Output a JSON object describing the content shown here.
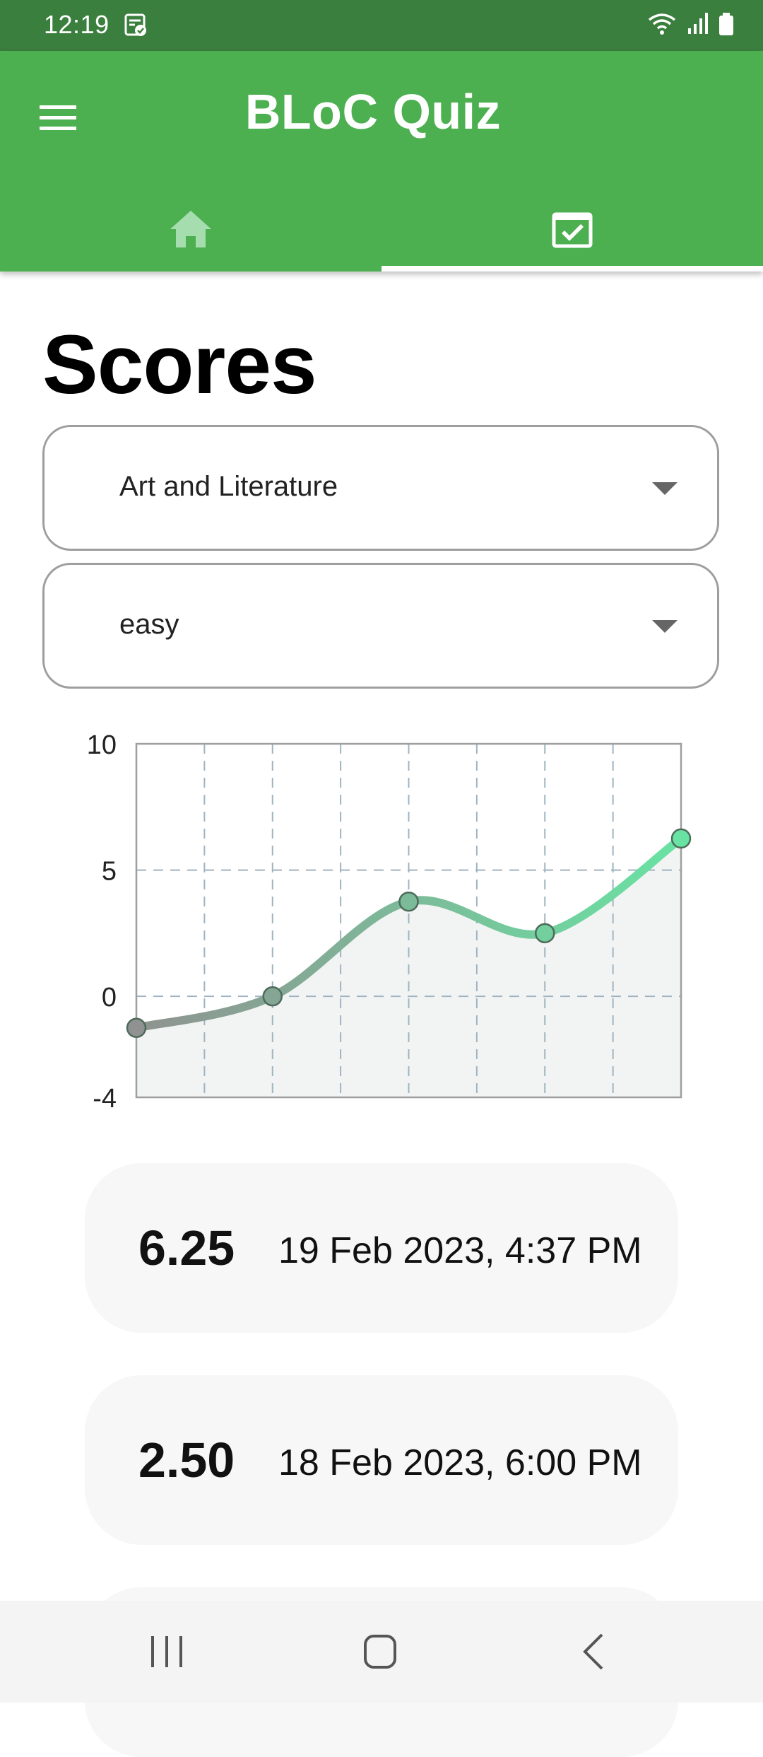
{
  "status_bar": {
    "time": "12:19",
    "icons": [
      "task-notification-icon",
      "wifi-icon",
      "signal-icon",
      "battery-icon"
    ]
  },
  "app_bar": {
    "title": "BLoC Quiz",
    "menu_icon": "hamburger-menu-icon",
    "background_color": "#4caf50",
    "tabs": [
      {
        "name": "home",
        "icon": "home-icon",
        "selected": false
      },
      {
        "name": "scores",
        "icon": "calendar-check-icon",
        "selected": true
      }
    ]
  },
  "page": {
    "title": "Scores"
  },
  "filters": {
    "category": {
      "value": "Art and Literature",
      "icon": "caret-down-icon"
    },
    "difficulty": {
      "value": "easy",
      "icon": "caret-down-icon"
    }
  },
  "chart_data": {
    "type": "line",
    "x": [
      1,
      2,
      3,
      4,
      5
    ],
    "values": [
      -1.25,
      0,
      3.75,
      2.5,
      6.25
    ],
    "ylim": [
      -4,
      10
    ],
    "yticks": [
      "10",
      "5",
      "0",
      "-4"
    ],
    "grid": true,
    "curve": "smooth",
    "area_fill": true,
    "colors": {
      "start": "#8f9290",
      "end": "#69e3a3",
      "area": "#f2f4f3",
      "grid": "#9fb3c2"
    }
  },
  "scores": [
    {
      "score": "6.25",
      "date": "19 Feb 2023, 4:37 PM"
    },
    {
      "score": "2.50",
      "date": "18 Feb 2023, 6:00 PM"
    }
  ],
  "nav_bar": {
    "icons": [
      "recents-icon",
      "home-circle-icon",
      "back-icon"
    ]
  }
}
